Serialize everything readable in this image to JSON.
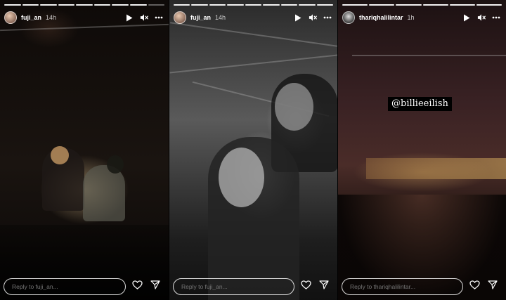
{
  "stories": [
    {
      "username": "fuji_an",
      "time": "14h",
      "progress_segments": 9,
      "progress_done": 8,
      "reply_placeholder": "Reply to fuji_an..."
    },
    {
      "username": "fuji_an",
      "time": "14h",
      "progress_segments": 9,
      "progress_done": 9,
      "reply_placeholder": "Reply to fuji_an..."
    },
    {
      "username": "thariqhalilintar",
      "time": "1h",
      "progress_segments": 6,
      "progress_done": 6,
      "mention": "@billieeilish",
      "reply_placeholder": "Reply to thariqhalilintar..."
    }
  ],
  "icons": {
    "play": "play-icon",
    "mute": "speaker-muted-icon",
    "more": "more-options-icon",
    "like": "heart-icon",
    "share": "send-icon"
  }
}
